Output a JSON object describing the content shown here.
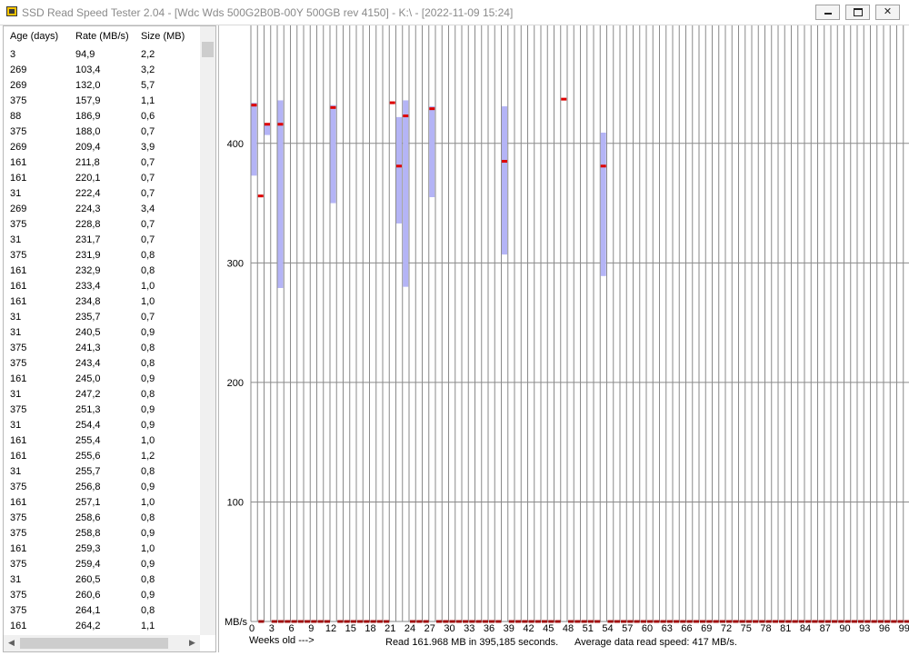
{
  "window": {
    "title": "SSD Read Speed Tester 2.04 - [Wdc  Wds 500G2B0B-00Y 500GB rev 4150] - K:\\ - [2022-11-09 15:24]"
  },
  "list": {
    "headers": [
      "Age (days)",
      "Rate (MB/s)",
      "Size (MB)"
    ],
    "rows": [
      [
        "3",
        "94,9",
        "2,2"
      ],
      [
        "269",
        "103,4",
        "3,2"
      ],
      [
        "269",
        "132,0",
        "5,7"
      ],
      [
        "375",
        "157,9",
        "1,1"
      ],
      [
        "88",
        "186,9",
        "0,6"
      ],
      [
        "375",
        "188,0",
        "0,7"
      ],
      [
        "269",
        "209,4",
        "3,9"
      ],
      [
        "161",
        "211,8",
        "0,7"
      ],
      [
        "161",
        "220,1",
        "0,7"
      ],
      [
        "31",
        "222,4",
        "0,7"
      ],
      [
        "269",
        "224,3",
        "3,4"
      ],
      [
        "375",
        "228,8",
        "0,7"
      ],
      [
        "31",
        "231,7",
        "0,7"
      ],
      [
        "375",
        "231,9",
        "0,8"
      ],
      [
        "161",
        "232,9",
        "0,8"
      ],
      [
        "161",
        "233,4",
        "1,0"
      ],
      [
        "161",
        "234,8",
        "1,0"
      ],
      [
        "31",
        "235,7",
        "0,7"
      ],
      [
        "31",
        "240,5",
        "0,9"
      ],
      [
        "375",
        "241,3",
        "0,8"
      ],
      [
        "375",
        "243,4",
        "0,8"
      ],
      [
        "161",
        "245,0",
        "0,9"
      ],
      [
        "31",
        "247,2",
        "0,8"
      ],
      [
        "375",
        "251,3",
        "0,9"
      ],
      [
        "31",
        "254,4",
        "0,9"
      ],
      [
        "161",
        "255,4",
        "1,0"
      ],
      [
        "161",
        "255,6",
        "1,2"
      ],
      [
        "31",
        "255,7",
        "0,8"
      ],
      [
        "375",
        "256,8",
        "0,9"
      ],
      [
        "161",
        "257,1",
        "1,0"
      ],
      [
        "375",
        "258,6",
        "0,8"
      ],
      [
        "375",
        "258,8",
        "0,9"
      ],
      [
        "161",
        "259,3",
        "1,0"
      ],
      [
        "375",
        "259,4",
        "0,9"
      ],
      [
        "31",
        "260,5",
        "0,8"
      ],
      [
        "375",
        "260,6",
        "0,9"
      ],
      [
        "375",
        "264,1",
        "0,8"
      ],
      [
        "161",
        "264,2",
        "1,1"
      ]
    ]
  },
  "chart_data": {
    "type": "scatter",
    "ylabel": "MB/s",
    "xlabel": "Weeks old --->",
    "ylim": [
      0,
      500
    ],
    "xlim": [
      0,
      100
    ],
    "yticks": [
      100,
      200,
      300,
      400
    ],
    "xticks": [
      0,
      3,
      6,
      9,
      12,
      15,
      18,
      21,
      24,
      27,
      30,
      33,
      36,
      39,
      42,
      45,
      48,
      51,
      54,
      57,
      60,
      63,
      66,
      69,
      72,
      75,
      78,
      81,
      84,
      87,
      90,
      93,
      96,
      99
    ],
    "xtick_labels": [
      "0",
      "3",
      "6",
      "9",
      "12",
      "15",
      "18",
      "21",
      "24",
      "27",
      "30",
      "33",
      "36",
      "39",
      "42",
      "45",
      "48",
      "51",
      "54",
      "57",
      "60",
      "63",
      "66",
      "69",
      "72",
      "75",
      "78",
      "81",
      "84",
      "87",
      "90",
      "93",
      "96",
      "99"
    ],
    "grid": true,
    "series": [
      {
        "values": [
          {
            "x": 0,
            "low": 373,
            "high": 434,
            "avg": 432
          },
          {
            "x": 1,
            "low": 356,
            "high": 356,
            "avg": 356
          },
          {
            "x": 2,
            "low": 407,
            "high": 417,
            "avg": 416
          },
          {
            "x": 4,
            "low": 279,
            "high": 436,
            "avg": 416
          },
          {
            "x": 12,
            "low": 350,
            "high": 432,
            "avg": 430
          },
          {
            "x": 21,
            "low": 434,
            "high": 434,
            "avg": 434
          },
          {
            "x": 22,
            "low": 333,
            "high": 422,
            "avg": 381
          },
          {
            "x": 23,
            "low": 280,
            "high": 436,
            "avg": 423
          },
          {
            "x": 27,
            "low": 355,
            "high": 431,
            "avg": 429
          },
          {
            "x": 38,
            "low": 307,
            "high": 431,
            "avg": 385
          },
          {
            "x": 47,
            "low": 437,
            "high": 437,
            "avg": 437
          },
          {
            "x": 53,
            "low": 289,
            "high": 409,
            "avg": 381
          }
        ]
      }
    ],
    "empty_weeks": [
      1,
      3,
      4,
      5,
      6,
      7,
      8,
      9,
      10,
      11,
      13,
      14,
      15,
      16,
      17,
      18,
      19,
      20,
      24,
      25,
      26,
      28,
      29,
      30,
      31,
      32,
      33,
      34,
      35,
      36,
      37,
      39,
      40,
      41,
      42,
      43,
      44,
      45,
      46,
      48,
      49,
      50,
      51,
      52,
      54,
      55,
      56,
      57,
      58,
      59,
      60,
      61,
      62,
      63,
      64,
      65,
      66,
      67,
      68,
      69,
      70,
      71,
      72,
      73,
      74,
      75,
      76,
      77,
      78,
      79,
      80,
      81,
      82,
      83,
      84,
      85,
      86,
      87,
      88,
      89,
      90,
      91,
      92,
      93,
      94,
      95,
      96,
      97,
      98,
      99
    ]
  },
  "footer": {
    "weeks_label": "Weeks old --->",
    "read_text": "Read 161.968 MB in 395,185 seconds.",
    "avg_text": "Average data read speed: 417 MB/s."
  },
  "colors": {
    "range": "#b4b4f6",
    "avg": "#dd0000",
    "empty": "#a01010",
    "grid": "#8a8a8a"
  }
}
